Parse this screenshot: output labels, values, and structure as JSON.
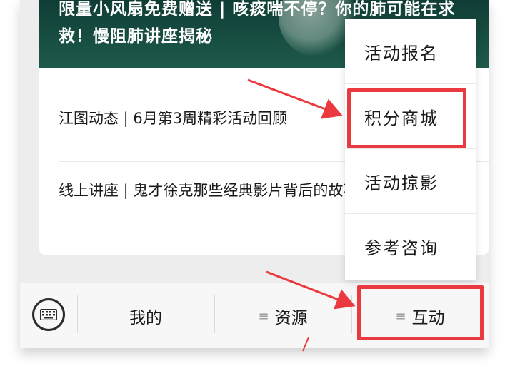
{
  "banner": {
    "title": "限量小风扇免费赠送 | 咳痰喘不停？你的肺可能在求救！慢阻肺讲座揭秘"
  },
  "news": [
    {
      "title": "江图动态 | 6月第3周精彩活动回顾"
    },
    {
      "title": "线上讲座 | 鬼才徐克那些经典影片背后的故事"
    }
  ],
  "popup_menu": {
    "items": [
      {
        "label": "活动报名"
      },
      {
        "label": "积分商城"
      },
      {
        "label": "活动掠影"
      },
      {
        "label": "参考咨询"
      }
    ]
  },
  "bottom_bar": {
    "keyboard_icon": "keyboard-icon",
    "tabs": [
      {
        "label": "我的",
        "menu_glyph": ""
      },
      {
        "label": "资源",
        "menu_glyph": "≡"
      },
      {
        "label": "互动",
        "menu_glyph": "≡"
      }
    ]
  },
  "annotations": {
    "highlight_color": "#ea3a3f"
  }
}
